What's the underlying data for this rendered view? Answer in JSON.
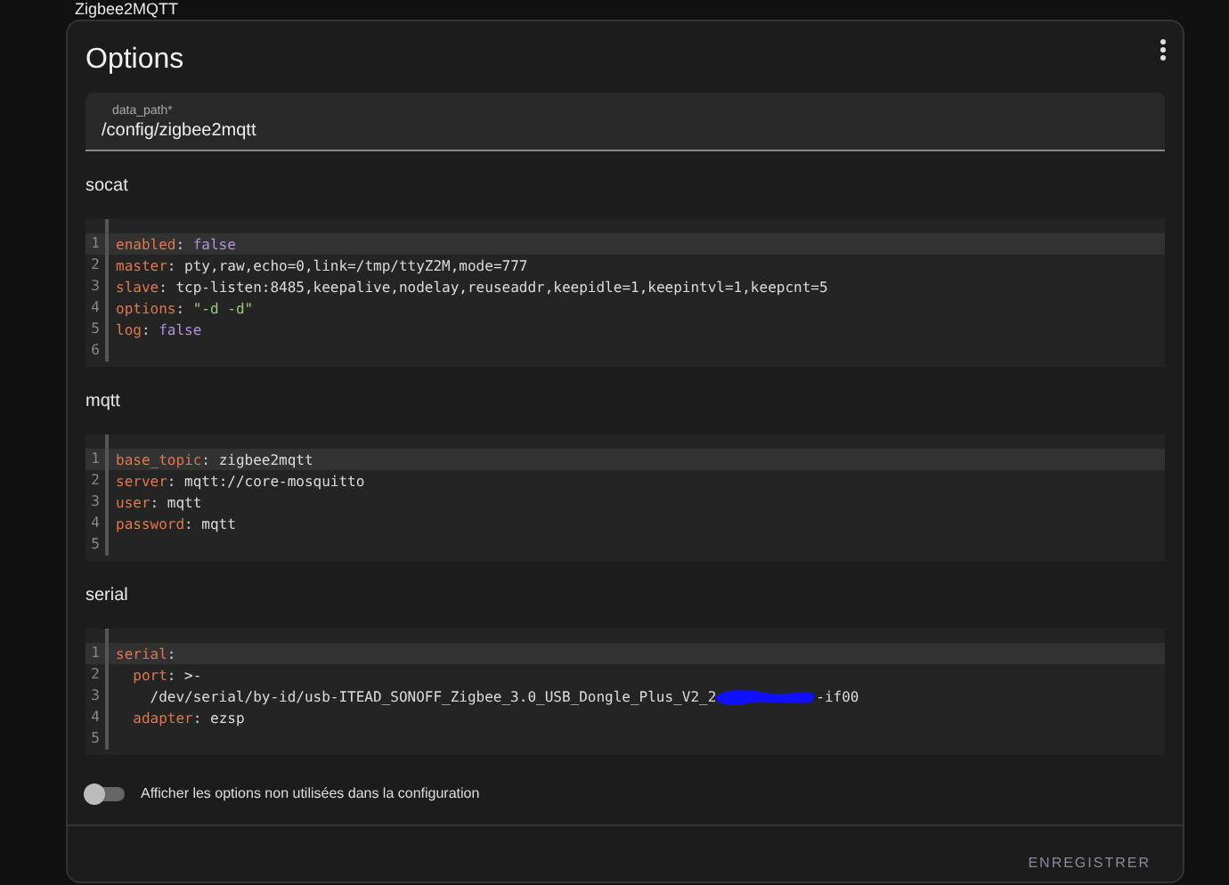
{
  "page_title": "Zigbee2MQTT",
  "card": {
    "title": "Options",
    "field": {
      "label": "data_path*",
      "value": "/config/zigbee2mqtt"
    },
    "sections": [
      {
        "title": "socat",
        "lines": [
          {
            "num": "1",
            "active": true,
            "segments": [
              {
                "t": "enabled",
                "kind": "key"
              },
              {
                "t": ": ",
                "kind": "punct"
              },
              {
                "t": "false",
                "kind": "bool"
              }
            ]
          },
          {
            "num": "2",
            "active": false,
            "segments": [
              {
                "t": "master",
                "kind": "key"
              },
              {
                "t": ": ",
                "kind": "punct"
              },
              {
                "t": "pty,raw,echo=0,link=/tmp/ttyZ2M,mode=777",
                "kind": "plain"
              }
            ]
          },
          {
            "num": "3",
            "active": false,
            "segments": [
              {
                "t": "slave",
                "kind": "key"
              },
              {
                "t": ": ",
                "kind": "punct"
              },
              {
                "t": "tcp-listen:8485,keepalive,nodelay,reuseaddr,keepidle=1,keepintvl=1,keepcnt=5",
                "kind": "plain"
              }
            ]
          },
          {
            "num": "4",
            "active": false,
            "segments": [
              {
                "t": "options",
                "kind": "key"
              },
              {
                "t": ": ",
                "kind": "punct"
              },
              {
                "t": "\"-d -d\"",
                "kind": "string"
              }
            ]
          },
          {
            "num": "5",
            "active": false,
            "segments": [
              {
                "t": "log",
                "kind": "key"
              },
              {
                "t": ": ",
                "kind": "punct"
              },
              {
                "t": "false",
                "kind": "bool"
              }
            ]
          },
          {
            "num": "6",
            "active": false
          }
        ]
      },
      {
        "title": "mqtt",
        "lines": [
          {
            "num": "1",
            "active": true,
            "segments": [
              {
                "t": "base_topic",
                "kind": "key"
              },
              {
                "t": ": ",
                "kind": "punct"
              },
              {
                "t": "zigbee2mqtt",
                "kind": "plain"
              }
            ]
          },
          {
            "num": "2",
            "active": false,
            "segments": [
              {
                "t": "server",
                "kind": "key"
              },
              {
                "t": ": ",
                "kind": "punct"
              },
              {
                "t": "mqtt://core-mosquitto",
                "kind": "plain"
              }
            ]
          },
          {
            "num": "3",
            "active": false,
            "segments": [
              {
                "t": "user",
                "kind": "key"
              },
              {
                "t": ": ",
                "kind": "punct"
              },
              {
                "t": "mqtt",
                "kind": "plain"
              }
            ]
          },
          {
            "num": "4",
            "active": false,
            "segments": [
              {
                "t": "password",
                "kind": "key"
              },
              {
                "t": ": ",
                "kind": "punct"
              },
              {
                "t": "mqtt",
                "kind": "plain"
              }
            ]
          },
          {
            "num": "5",
            "active": false
          }
        ]
      },
      {
        "title": "serial",
        "lines": [
          {
            "num": "1",
            "active": true,
            "segments": [
              {
                "t": "serial",
                "kind": "key"
              },
              {
                "t": ":",
                "kind": "punct"
              }
            ]
          },
          {
            "num": "2",
            "active": false,
            "segments": [
              {
                "t": "  port",
                "kind": "key"
              },
              {
                "t": ": ",
                "kind": "punct"
              },
              {
                "t": ">-",
                "kind": "plain"
              }
            ]
          },
          {
            "num": "3",
            "active": false,
            "segments": [
              {
                "t": "    /dev/serial/by-id/usb-ITEAD_SONOFF_Zigbee_3.0_USB_Dongle_Plus_V2_2",
                "kind": "plain"
              },
              {
                "kind": "redacted"
              },
              {
                "t": "-if00",
                "kind": "plain"
              }
            ]
          },
          {
            "num": "4",
            "active": false,
            "segments": [
              {
                "t": "  adapter",
                "kind": "key"
              },
              {
                "t": ": ",
                "kind": "punct"
              },
              {
                "t": "ezsp",
                "kind": "plain"
              }
            ]
          },
          {
            "num": "5",
            "active": false
          }
        ]
      }
    ],
    "toggle": {
      "label": "Afficher les options non utilisées dans la configuration",
      "on": false
    },
    "save_button": "ENREGISTRER"
  }
}
